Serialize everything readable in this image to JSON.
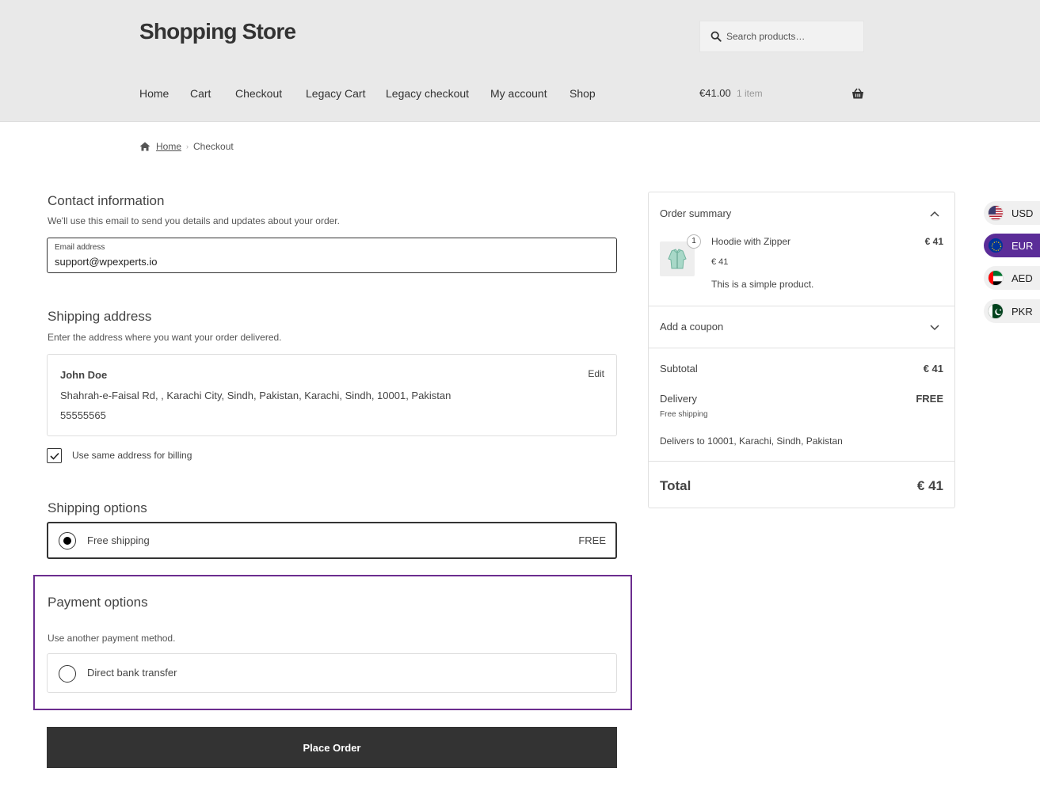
{
  "header": {
    "site_title": "Shopping Store",
    "search_placeholder": "Search products…",
    "nav": [
      "Home",
      "Cart",
      "Checkout",
      "Legacy Cart",
      "Legacy checkout",
      "My account",
      "Shop"
    ],
    "cart_total": "€41.00",
    "cart_count": "1 item"
  },
  "breadcrumb": {
    "home": "Home",
    "current": "Checkout"
  },
  "contact": {
    "title": "Contact information",
    "description": "We'll use this email to send you details and updates about your order.",
    "email_label": "Email address",
    "email_value": "support@wpexperts.io"
  },
  "shipping_address": {
    "title": "Shipping address",
    "description": "Enter the address where you want your order delivered.",
    "name": "John Doe",
    "address": "Shahrah-e-Faisal Rd, , Karachi City, Sindh, Pakistan, Karachi, Sindh, 10001, Pakistan",
    "phone": "55555565",
    "edit_label": "Edit",
    "billing_same_label": "Use same address for billing",
    "billing_same_checked": true
  },
  "shipping_options": {
    "title": "Shipping options",
    "option_label": "Free shipping",
    "option_price": "FREE"
  },
  "payment": {
    "title": "Payment options",
    "description": "Use another payment method.",
    "option_label": "Direct bank transfer",
    "highlight_color": "#6b2d8f"
  },
  "place_order_label": "Place Order",
  "summary": {
    "title": "Order summary",
    "item": {
      "quantity": "1",
      "name": "Hoodie with Zipper",
      "line_total": "€ 41",
      "unit_price": "€ 41",
      "description": "This is a simple product."
    },
    "coupon_label": "Add a coupon",
    "subtotal_label": "Subtotal",
    "subtotal_value": "€ 41",
    "delivery_label": "Delivery",
    "delivery_value": "FREE",
    "delivery_method": "Free shipping",
    "delivers_to": "Delivers to 10001, Karachi, Sindh, Pakistan",
    "total_label": "Total",
    "total_value": "€ 41"
  },
  "currencies": [
    {
      "code": "USD",
      "active": false
    },
    {
      "code": "EUR",
      "active": true
    },
    {
      "code": "AED",
      "active": false
    },
    {
      "code": "PKR",
      "active": false
    }
  ]
}
